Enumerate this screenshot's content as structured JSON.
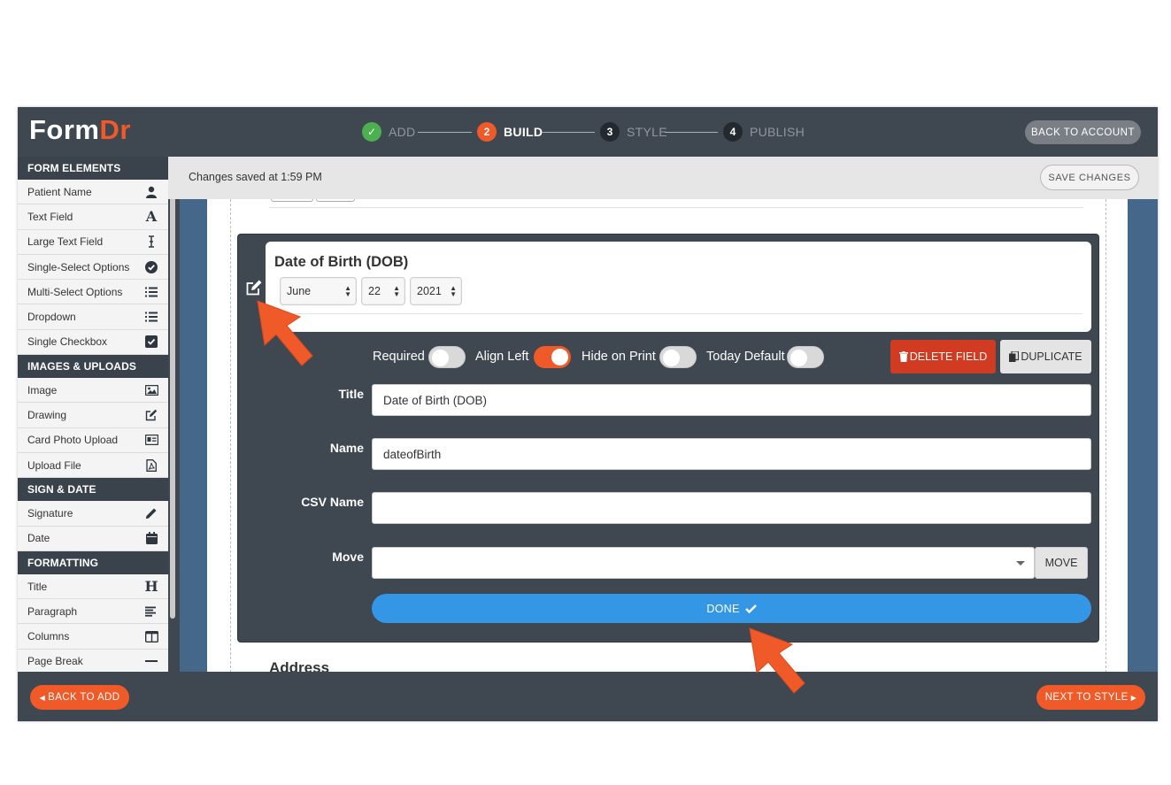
{
  "app": {
    "logo_part1": "Form",
    "logo_part2": "Dr"
  },
  "steps": [
    {
      "num": "✓",
      "label": "ADD",
      "state": "done"
    },
    {
      "num": "2",
      "label": "BUILD",
      "state": "active"
    },
    {
      "num": "3",
      "label": "STYLE",
      "state": "todo"
    },
    {
      "num": "4",
      "label": "PUBLISH",
      "state": "todo"
    }
  ],
  "header": {
    "back_account": "BACK TO ACCOUNT"
  },
  "status": {
    "saved_text": "Changes saved at 1:59 PM",
    "save_button": "SAVE CHANGES"
  },
  "sidebar": {
    "sections": [
      {
        "title": "FORM ELEMENTS",
        "items": [
          {
            "label": "Patient Name",
            "icon": "person-icon"
          },
          {
            "label": "Text Field",
            "icon": "text-a-icon"
          },
          {
            "label": "Large Text Field",
            "icon": "text-cursor-icon"
          },
          {
            "label": "Single-Select Options",
            "icon": "check-circle-icon"
          },
          {
            "label": "Multi-Select Options",
            "icon": "list-icon"
          },
          {
            "label": "Dropdown",
            "icon": "list-icon"
          },
          {
            "label": "Single Checkbox",
            "icon": "checkbox-icon"
          }
        ]
      },
      {
        "title": "IMAGES & UPLOADS",
        "items": [
          {
            "label": "Image",
            "icon": "image-icon"
          },
          {
            "label": "Drawing",
            "icon": "edit-icon"
          },
          {
            "label": "Card Photo Upload",
            "icon": "id-card-icon"
          },
          {
            "label": "Upload File",
            "icon": "file-pdf-icon"
          }
        ]
      },
      {
        "title": "SIGN & DATE",
        "items": [
          {
            "label": "Signature",
            "icon": "pencil-icon"
          },
          {
            "label": "Date",
            "icon": "calendar-icon"
          }
        ]
      },
      {
        "title": "FORMATTING",
        "items": [
          {
            "label": "Title",
            "icon": "heading-icon"
          },
          {
            "label": "Paragraph",
            "icon": "align-left-icon"
          },
          {
            "label": "Columns",
            "icon": "columns-icon"
          },
          {
            "label": "Page Break",
            "icon": "minus-icon"
          }
        ]
      }
    ]
  },
  "field": {
    "title": "Date of Birth (DOB)",
    "month": "June",
    "day": "22",
    "year": "2021"
  },
  "toggles": [
    {
      "label": "Required",
      "on": false
    },
    {
      "label": "Align Left",
      "on": true
    },
    {
      "label": "Hide on Print",
      "on": false
    },
    {
      "label": "Today Default",
      "on": false
    }
  ],
  "actions": {
    "delete": "DELETE FIELD",
    "duplicate": "DUPLICATE"
  },
  "form": {
    "title_label": "Title",
    "title_value": "Date of Birth (DOB)",
    "name_label": "Name",
    "name_value": "dateofBirth",
    "csv_label": "CSV Name",
    "csv_value": "",
    "move_label": "Move",
    "move_value": "",
    "move_button": "MOVE",
    "done_button": "DONE"
  },
  "next_field_title": "Address",
  "footer": {
    "back": "BACK TO ADD",
    "next": "NEXT TO STYLE"
  },
  "colors": {
    "accent": "#f05a28",
    "dark": "#3f4751",
    "blue": "#3497e6",
    "danger": "#d03b22",
    "canvas": "#456789"
  }
}
